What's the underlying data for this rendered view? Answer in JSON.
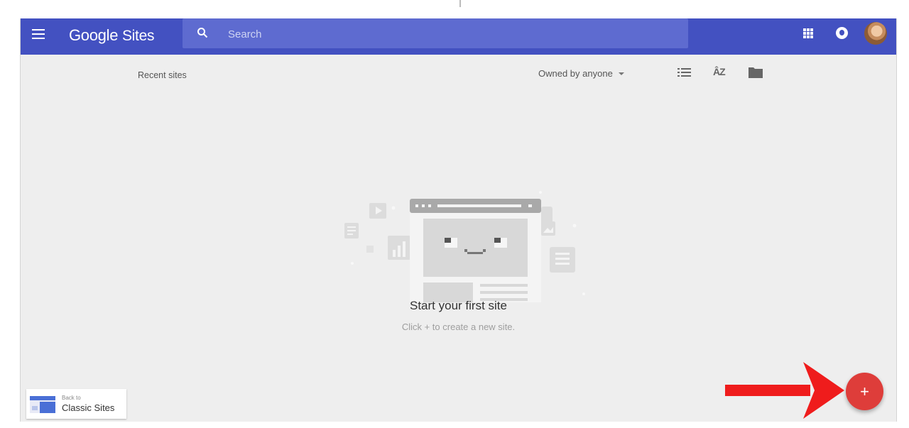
{
  "app": {
    "title_main": "Google",
    "title_sub": "Sites"
  },
  "header": {
    "search_placeholder": "Search",
    "icons": [
      "menu-icon",
      "search-icon",
      "apps-icon",
      "notifications-icon",
      "avatar"
    ]
  },
  "toolbar": {
    "recent_label": "Recent sites",
    "owner_filter": "Owned by anyone",
    "view_icons": [
      "list-view-icon",
      "sort-az-icon",
      "folder-icon"
    ]
  },
  "empty_state": {
    "title": "Start your first site",
    "subtitle": "Click + to create a new site."
  },
  "back_link": {
    "small": "Back to",
    "label": "Classic Sites"
  },
  "fab": {
    "label": "+",
    "color": "#de3d3a"
  },
  "colors": {
    "header": "#4351c1",
    "search": "#5e6bd0",
    "background": "#eeeeee",
    "annotation_arrow": "#ef1c1c"
  }
}
